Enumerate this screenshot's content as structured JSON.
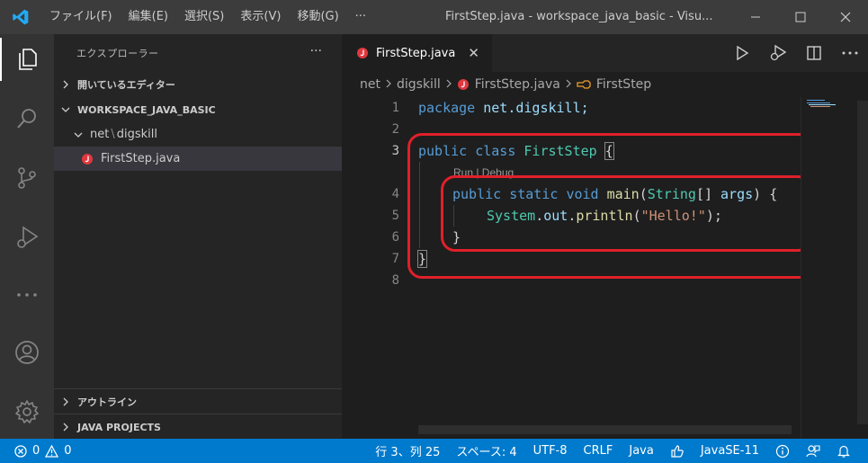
{
  "titlebar": {
    "menus": [
      "ファイル(F)",
      "編集(E)",
      "選択(S)",
      "表示(V)",
      "移動(G)",
      "···"
    ],
    "title": "FirstStep.java - workspace_java_basic - Visu..."
  },
  "sidebar": {
    "title": "エクスプローラー",
    "more": "···",
    "open_editors": "開いているエディター",
    "workspace": "WORKSPACE_JAVA_BASIC",
    "folder": "net",
    "folder_sep": "\\",
    "folder2": "digskill",
    "file": "FirstStep.java",
    "outline": "アウトライン",
    "java_projects": "JAVA PROJECTS"
  },
  "tab": {
    "label": "FirstStep.java",
    "close": "✕"
  },
  "breadcrumb": {
    "part1": "net",
    "part2": "digskill",
    "part3": "FirstStep.java",
    "part4": "FirstStep"
  },
  "editor": {
    "line_numbers": [
      "1",
      "2",
      "3",
      "4",
      "5",
      "6",
      "7",
      "8"
    ],
    "codelens": "Run | Debug",
    "code": {
      "l1_kw": "package",
      "l1_rest": " net.digskill;",
      "l3_kw1": "public",
      "l3_kw2": "class",
      "l3_name": "FirstStep",
      "l3_brace": "{",
      "l4_kw1": "public",
      "l4_kw2": "static",
      "l4_kw3": "void",
      "l4_fn": "main",
      "l4_p1": "(",
      "l4_ty": "String",
      "l4_p2": "[] ",
      "l4_var": "args",
      "l4_p3": ") {",
      "l5_ty": "System",
      "l5_dot1": ".",
      "l5_var": "out",
      "l5_dot2": ".",
      "l5_fn": "println",
      "l5_p1": "(",
      "l5_str": "\"Hello!\"",
      "l5_p2": ");",
      "l6": "}",
      "l7": "}"
    }
  },
  "statusbar": {
    "errors": "0",
    "warnings": "0",
    "position": "行 3、列 25",
    "spaces": "スペース: 4",
    "encoding": "UTF-8",
    "eol": "CRLF",
    "language": "Java",
    "runtime": "JavaSE-11"
  },
  "colors": {
    "status_bar": "#007acc",
    "highlight": "#e0202a"
  }
}
